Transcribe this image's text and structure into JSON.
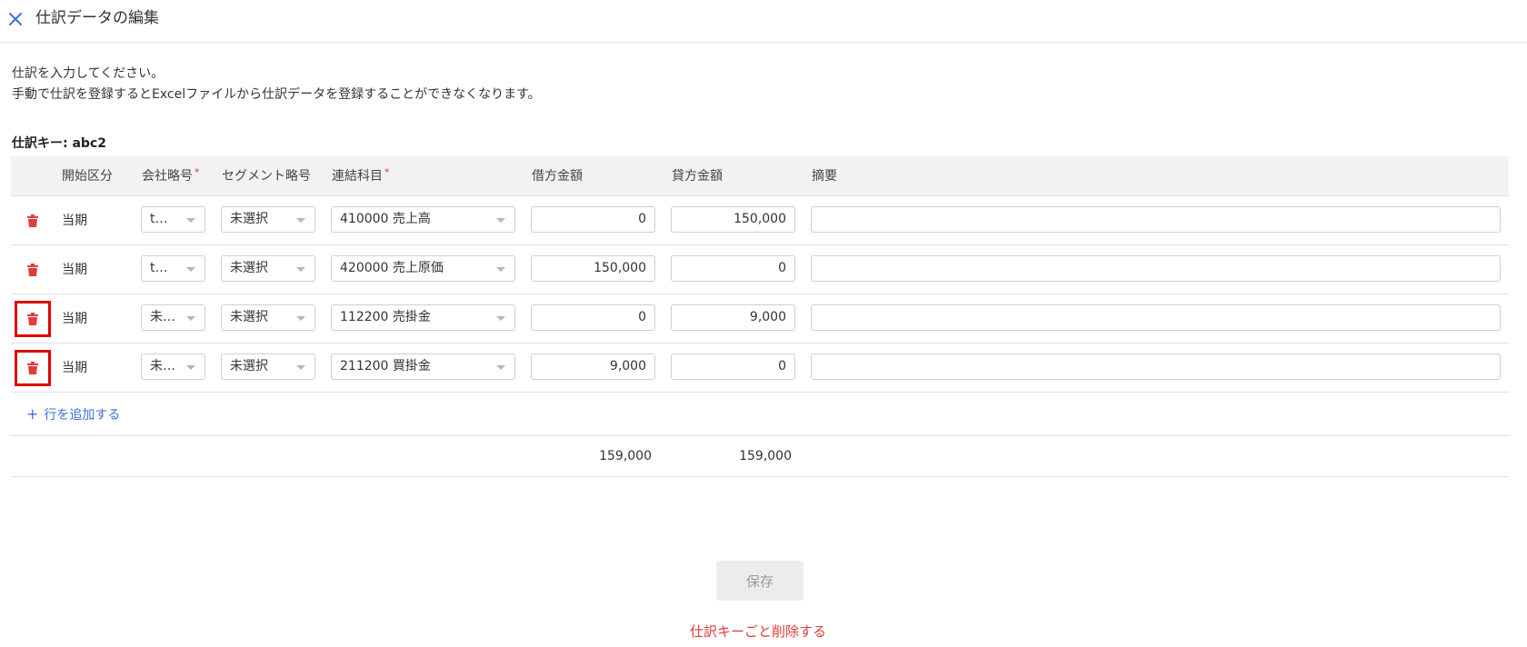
{
  "header": {
    "title": "仕訳データの編集",
    "close_icon": "close-icon",
    "close_color": "#3d6fd6"
  },
  "description": {
    "line1": "仕訳を入力してください。",
    "line2": "手動で仕訳を登録するとExcelファイルから仕訳データを登録することができなくなります。"
  },
  "journal_key_label": "仕訳キー: abc2",
  "table": {
    "columns": {
      "period": "開始区分",
      "company": "会社略号",
      "segment": "セグメント略号",
      "account": "連結科目",
      "debit": "借方金額",
      "credit": "貸方金額",
      "memo": "摘要"
    },
    "required_mark": "*",
    "rows": [
      {
        "period": "当期",
        "company": "t…",
        "segment": "未選択",
        "account": "410000 売上高",
        "debit": "0",
        "credit": "150,000",
        "memo": ""
      },
      {
        "period": "当期",
        "company": "t…",
        "segment": "未選択",
        "account": "420000 売上原価",
        "debit": "150,000",
        "credit": "0",
        "memo": ""
      },
      {
        "period": "当期",
        "company": "未…",
        "segment": "未選択",
        "account": "112200 売掛金",
        "debit": "0",
        "credit": "9,000",
        "memo": ""
      },
      {
        "period": "当期",
        "company": "未…",
        "segment": "未選択",
        "account": "211200 買掛金",
        "debit": "9,000",
        "credit": "0",
        "memo": ""
      }
    ],
    "add_row_label": "行を追加する",
    "totals": {
      "debit": "159,000",
      "credit": "159,000"
    }
  },
  "actions": {
    "save_label": "保存",
    "delete_key_label": "仕訳キーごと削除する"
  },
  "colors": {
    "accent": "#3d6fd6",
    "danger": "#e23b3b",
    "highlight": "#e00000"
  }
}
